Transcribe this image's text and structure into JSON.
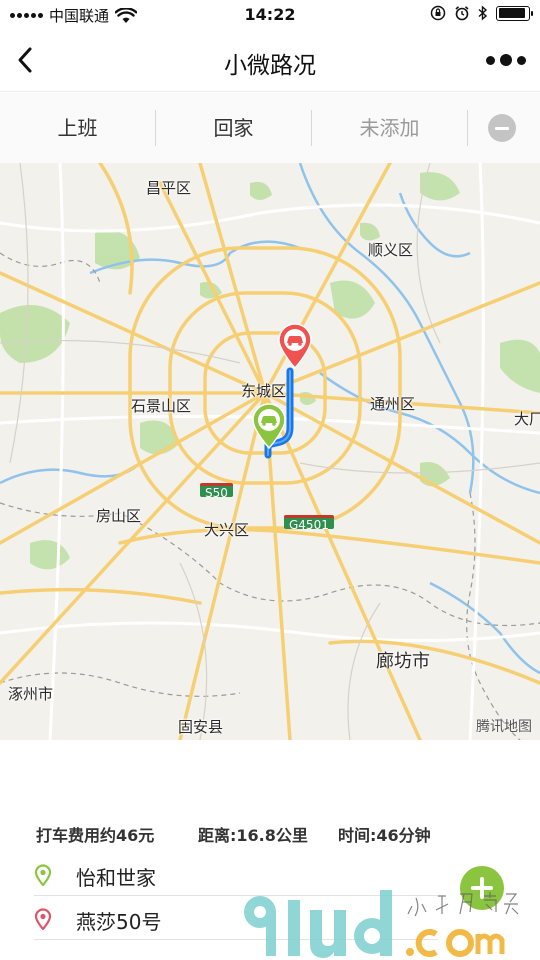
{
  "status_bar": {
    "carrier": "中国联通",
    "time": "14:22"
  },
  "nav": {
    "title": "小微路况"
  },
  "tabs": [
    {
      "label": "上班",
      "active": true
    },
    {
      "label": "回家",
      "active": true
    },
    {
      "label": "未添加",
      "active": false
    }
  ],
  "map": {
    "labels": {
      "changping": "昌平区",
      "shunyi": "顺义区",
      "dongcheng": "东城区",
      "shijingshan": "石景山区",
      "tongzhou": "通州区",
      "dachang": "大厂",
      "fangshan": "房山区",
      "daxing": "大兴区",
      "langfang": "廊坊市",
      "zhuozhou": "涿州市",
      "guan": "固安县"
    },
    "shields": {
      "s50": "S50",
      "g4501": "G4501"
    },
    "attribution": "腾讯地图",
    "colors": {
      "route": "#1a78e6",
      "start_pin": "#8bc53f",
      "end_pin": "#f0524f"
    }
  },
  "trip": {
    "fare": "打车费用约46元",
    "distance": "距离:16.8公里",
    "duration": "时间:46分钟"
  },
  "places": [
    {
      "name": "怡和世家",
      "color": "#8bc53f"
    },
    {
      "name": "燕莎50号",
      "color": "#e0546a"
    }
  ],
  "watermark": {
    "brand": "91ud.com",
    "tagline": "小程序商店"
  }
}
